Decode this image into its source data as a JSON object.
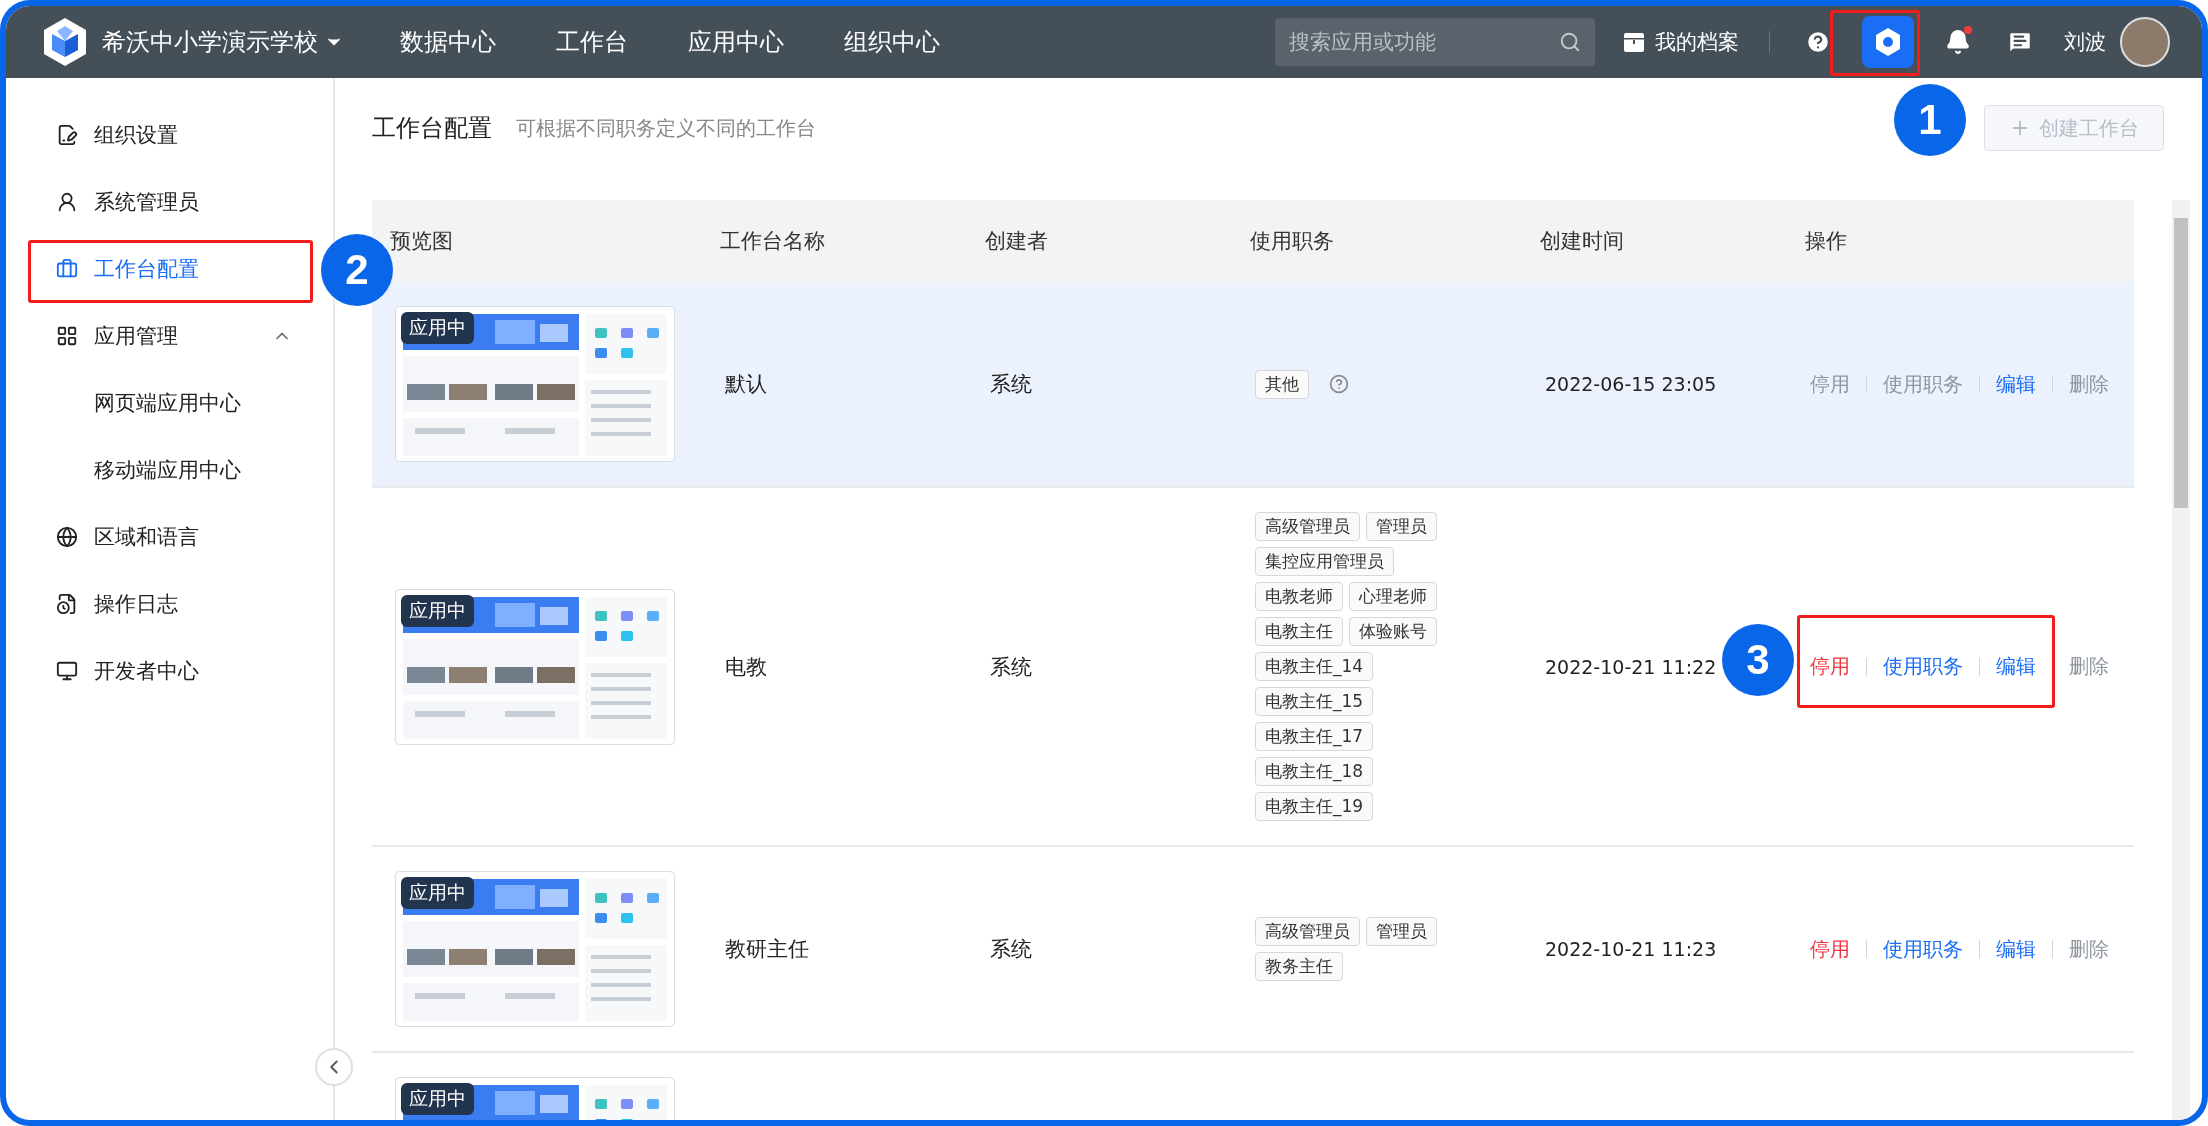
{
  "top_bar": {
    "school": "希沃中小学演示学校",
    "nav": [
      "数据中心",
      "工作台",
      "应用中心",
      "组织中心"
    ],
    "search": {
      "placeholder": "搜索应用或功能"
    },
    "profile_link": "我的档案",
    "user_name": "刘波",
    "notification_dot": true
  },
  "sidebar": {
    "items": [
      {
        "label": "组织设置",
        "selected": false
      },
      {
        "label": "系统管理员",
        "selected": false
      },
      {
        "label": "工作台配置",
        "selected": true
      },
      {
        "label": "应用管理",
        "selected": false,
        "expanded": true,
        "children": [
          {
            "label": "网页端应用中心",
            "selected": false
          },
          {
            "label": "移动端应用中心",
            "selected": false
          }
        ]
      },
      {
        "label": "区域和语言",
        "selected": false
      },
      {
        "label": "操作日志",
        "selected": false
      },
      {
        "label": "开发者中心",
        "selected": false
      }
    ]
  },
  "page": {
    "title": "工作台配置",
    "subtitle": "可根据不同职务定义不同的工作台",
    "create_button": {
      "label": "创建工作台",
      "disabled": true
    }
  },
  "table": {
    "columns": [
      "预览图",
      "工作台名称",
      "创建者",
      "使用职务",
      "创建时间",
      "操作"
    ],
    "rows": [
      {
        "badge": "应用中",
        "name": "默认",
        "creator": "系统",
        "roles": [
          "其他"
        ],
        "roles_help": true,
        "time": "2022-06-15 23:05",
        "selected": true,
        "actions": [
          {
            "label": "停用",
            "kind": "danger",
            "disabled": true
          },
          {
            "label": "使用职务",
            "kind": "primary",
            "disabled": true
          },
          {
            "label": "编辑",
            "kind": "primary",
            "disabled": false
          },
          {
            "label": "删除",
            "kind": "danger",
            "disabled": true
          }
        ]
      },
      {
        "badge": "应用中",
        "name": "电教",
        "creator": "系统",
        "roles": [
          "高级管理员",
          "管理员",
          "集控应用管理员",
          "电教老师",
          "心理老师",
          "电教主任",
          "体验账号",
          "电教主任_14",
          "电教主任_15",
          "电教主任_17",
          "电教主任_18",
          "电教主任_19"
        ],
        "roles_help": false,
        "time": "2022-10-21 11:22",
        "selected": false,
        "actions": [
          {
            "label": "停用",
            "kind": "danger",
            "disabled": false
          },
          {
            "label": "使用职务",
            "kind": "primary",
            "disabled": false
          },
          {
            "label": "编辑",
            "kind": "primary",
            "disabled": false
          },
          {
            "label": "删除",
            "kind": "danger",
            "disabled": true
          }
        ]
      },
      {
        "badge": "应用中",
        "name": "教研主任",
        "creator": "系统",
        "roles": [
          "高级管理员",
          "管理员",
          "教务主任"
        ],
        "roles_help": false,
        "time": "2022-10-21 11:23",
        "selected": false,
        "actions": [
          {
            "label": "停用",
            "kind": "danger",
            "disabled": false
          },
          {
            "label": "使用职务",
            "kind": "primary",
            "disabled": false
          },
          {
            "label": "编辑",
            "kind": "primary",
            "disabled": false
          },
          {
            "label": "删除",
            "kind": "danger",
            "disabled": true
          }
        ]
      },
      {
        "badge": "应用中",
        "selected": false
      }
    ]
  },
  "annotations": [
    "1",
    "2",
    "3"
  ]
}
